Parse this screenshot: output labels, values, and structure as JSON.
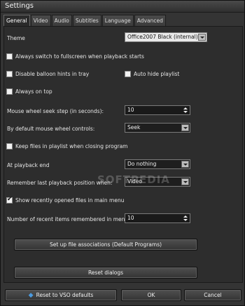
{
  "window": {
    "title": "Settings"
  },
  "tabs": [
    {
      "label": "General",
      "active": true
    },
    {
      "label": "Video",
      "active": false
    },
    {
      "label": "Audio",
      "active": false
    },
    {
      "label": "Subtitles",
      "active": false
    },
    {
      "label": "Language",
      "active": false
    },
    {
      "label": "Advanced",
      "active": false
    }
  ],
  "general": {
    "theme": {
      "label": "Theme",
      "value": "Office2007 Black (internal)"
    },
    "always_fullscreen": {
      "label": "Always switch to fullscreen when playback starts",
      "checked": false
    },
    "disable_balloon": {
      "label": "Disable balloon hints in tray",
      "checked": false
    },
    "auto_hide_playlist": {
      "label": "Auto hide playlist",
      "checked": false
    },
    "always_on_top": {
      "label": "Always on top",
      "checked": false
    },
    "wheel_seek_step": {
      "label": "Mouse wheel seek step (in seconds):",
      "value": "10"
    },
    "wheel_controls": {
      "label": "By default mouse wheel controls:",
      "value": "Seek"
    },
    "keep_playlist": {
      "label": "Keep files in playlist when closing program",
      "checked": false
    },
    "playback_end": {
      "label": "At playback end",
      "value": "Do nothing"
    },
    "remember_position": {
      "label": "Remember last playback position when:",
      "value": "Video"
    },
    "show_recent": {
      "label": "Show recently opened files in main menu",
      "checked": true
    },
    "recent_count": {
      "label": "Number of recent items remembered in menu",
      "value": "10"
    },
    "file_assoc_button": "Set up file associations (Default Programs)",
    "reset_dialogs_button": "Reset dialogs"
  },
  "footer": {
    "reset_defaults": "Reset to VSO defaults",
    "ok": "OK",
    "cancel": "Cancel"
  },
  "watermark": "SOFTPEDIA",
  "colors": {
    "background": "#2d2d2d",
    "text": "#e6e6e6",
    "check_mark": "#111111"
  }
}
